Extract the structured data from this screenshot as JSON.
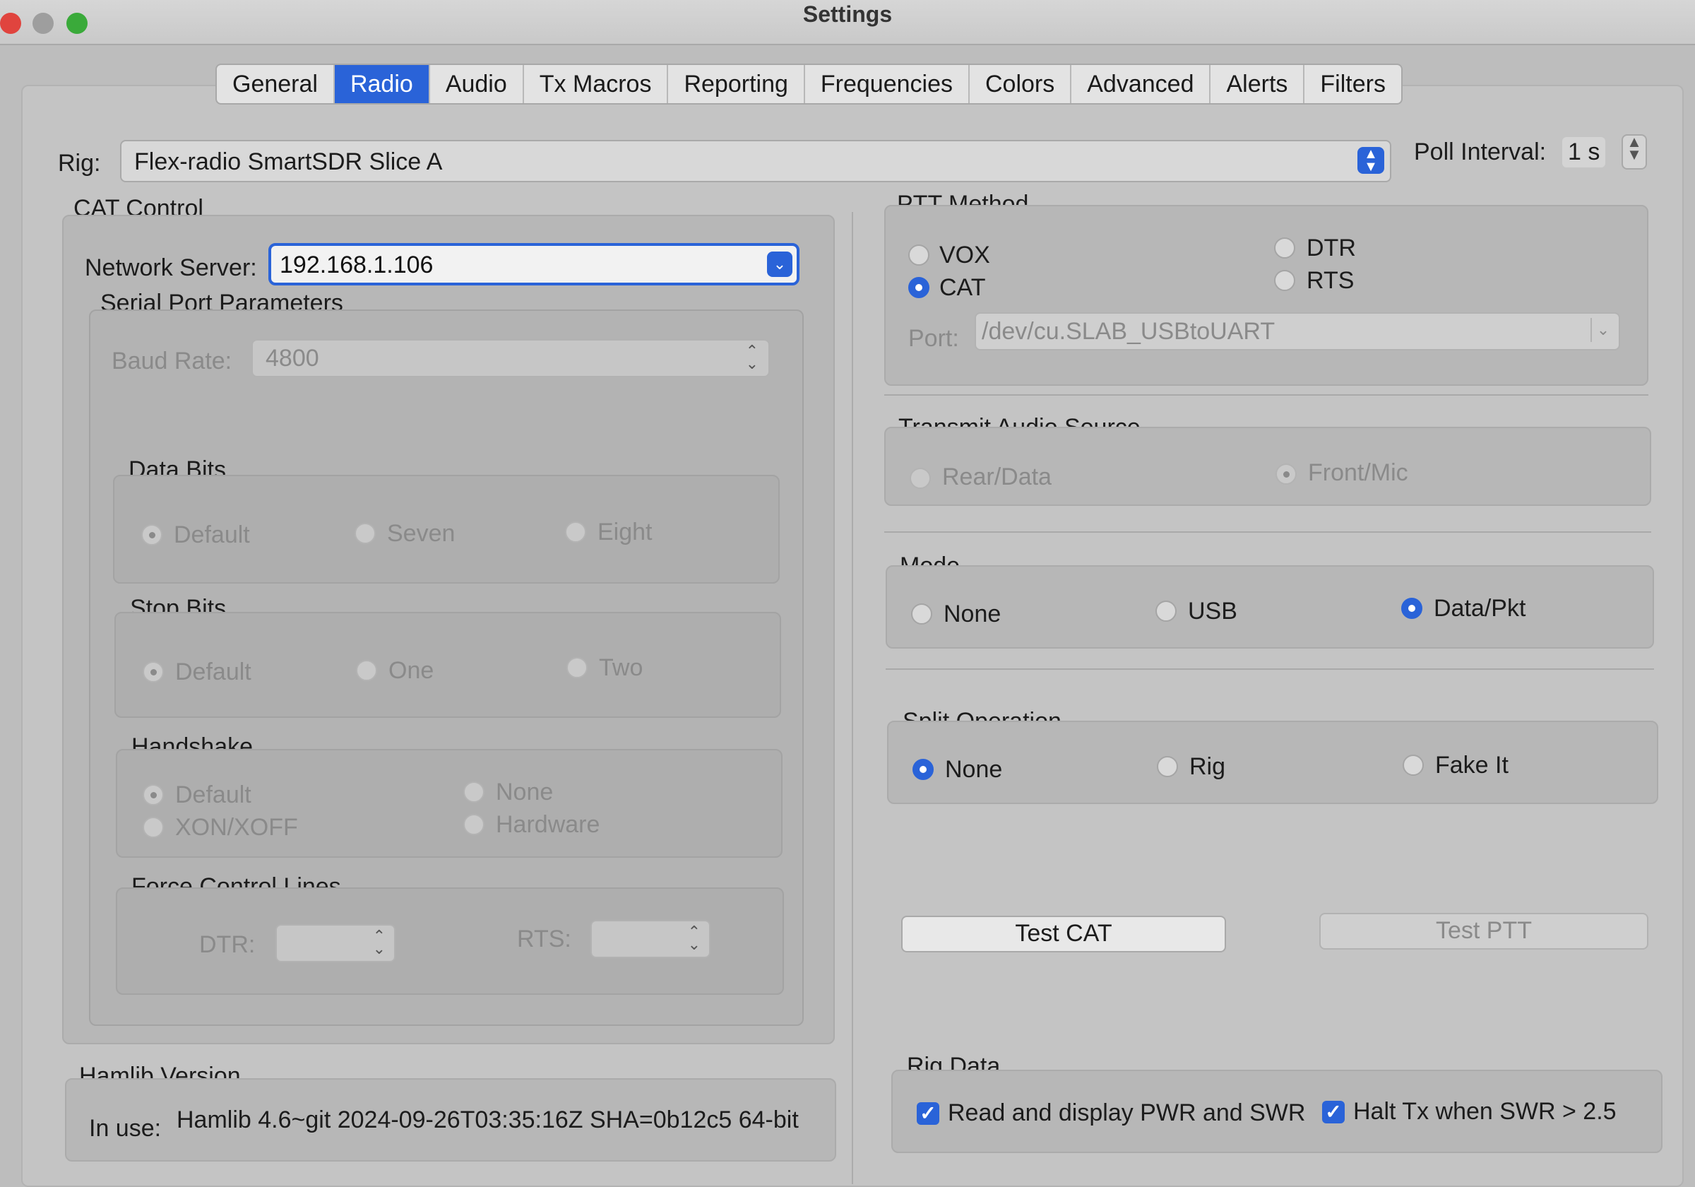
{
  "window": {
    "title": "Settings"
  },
  "tabs": [
    "General",
    "Radio",
    "Audio",
    "Tx Macros",
    "Reporting",
    "Frequencies",
    "Colors",
    "Advanced",
    "Alerts",
    "Filters"
  ],
  "active_tab": "Radio",
  "rig": {
    "label": "Rig:",
    "value": "Flex-radio SmartSDR Slice A"
  },
  "poll": {
    "label": "Poll Interval:",
    "value": "1 s"
  },
  "cat": {
    "title": "CAT Control",
    "network_label": "Network Server:",
    "network_value": "192.168.1.106",
    "serial_title": "Serial Port Parameters",
    "baud_label": "Baud Rate:",
    "baud_value": "4800",
    "data_bits": {
      "title": "Data Bits",
      "options": [
        "Default",
        "Seven",
        "Eight"
      ]
    },
    "stop_bits": {
      "title": "Stop Bits",
      "options": [
        "Default",
        "One",
        "Two"
      ]
    },
    "handshake": {
      "title": "Handshake",
      "options": [
        "Default",
        "None",
        "XON/XOFF",
        "Hardware"
      ]
    },
    "force": {
      "title": "Force Control Lines",
      "dtr_label": "DTR:",
      "rts_label": "RTS:"
    }
  },
  "hamlib": {
    "title": "Hamlib Version",
    "in_use_label": "In use:",
    "value": "Hamlib 4.6~git 2024-09-26T03:35:16Z SHA=0b12c5 64-bit"
  },
  "ptt": {
    "title": "PTT Method",
    "options": [
      "VOX",
      "CAT",
      "DTR",
      "RTS"
    ],
    "selected": "CAT",
    "port_label": "Port:",
    "port_value": "/dev/cu.SLAB_USBtoUART"
  },
  "tx_audio": {
    "title": "Transmit Audio Source",
    "options": [
      "Rear/Data",
      "Front/Mic"
    ],
    "selected": "Front/Mic"
  },
  "mode": {
    "title": "Mode",
    "options": [
      "None",
      "USB",
      "Data/Pkt"
    ],
    "selected": "Data/Pkt"
  },
  "split": {
    "title": "Split Operation",
    "options": [
      "None",
      "Rig",
      "Fake It"
    ],
    "selected": "None"
  },
  "buttons": {
    "test_cat": "Test CAT",
    "test_ptt": "Test PTT"
  },
  "rig_data": {
    "title": "Rig Data",
    "pwr_swr": "Read and display PWR and SWR",
    "halt_tx": "Halt Tx when SWR > 2.5",
    "pwr_swr_checked": true,
    "halt_tx_checked": true
  },
  "colors": {
    "accent": "#2a63d8",
    "close": "#e0443e",
    "minimize": "#9e9e9e",
    "zoom": "#3aaa3a"
  }
}
